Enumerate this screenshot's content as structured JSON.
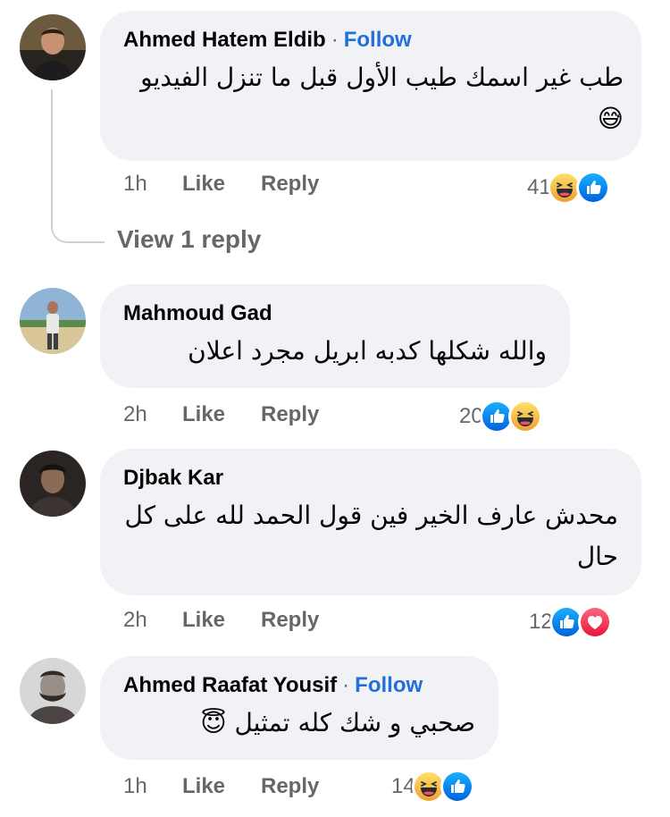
{
  "comments": [
    {
      "author": "Ahmed Hatem Eldib",
      "separator": "·",
      "follow": "Follow",
      "text": "طب غير اسمك طيب الأول قبل ما تنزل الفيديو 😅",
      "time": "1h",
      "like": "Like",
      "reply": "Reply",
      "reaction_count": "41",
      "reactions": [
        "laugh-icon",
        "like-icon"
      ]
    },
    {
      "author": "Mahmoud Gad",
      "text": "والله شكلها كدبه ابريل مجرد اعلان",
      "time": "2h",
      "like": "Like",
      "reply": "Reply",
      "reaction_count": "20",
      "reactions": [
        "like-icon",
        "laugh-icon"
      ]
    },
    {
      "author": "Djbak Kar",
      "text": "محدش عارف الخير فين قول الحمد لله على كل حال",
      "time": "2h",
      "like": "Like",
      "reply": "Reply",
      "reaction_count": "12",
      "reactions": [
        "like-icon",
        "love-icon"
      ]
    },
    {
      "author": "Ahmed Raafat Yousif",
      "separator": "·",
      "follow": "Follow",
      "text": "صحبي و شك كله تمثيل 😇",
      "time": "1h",
      "like": "Like",
      "reply": "Reply",
      "reaction_count": "14",
      "reactions": [
        "laugh-icon",
        "like-icon"
      ]
    }
  ],
  "view_replies": "View 1 reply",
  "colors": {
    "bubble": "#f0f2f5",
    "follow": "#216fdb",
    "meta": "#65676b",
    "like_blue": "#1877f2",
    "laugh_yellow": "#f7b125",
    "love_red": "#f33e58"
  }
}
